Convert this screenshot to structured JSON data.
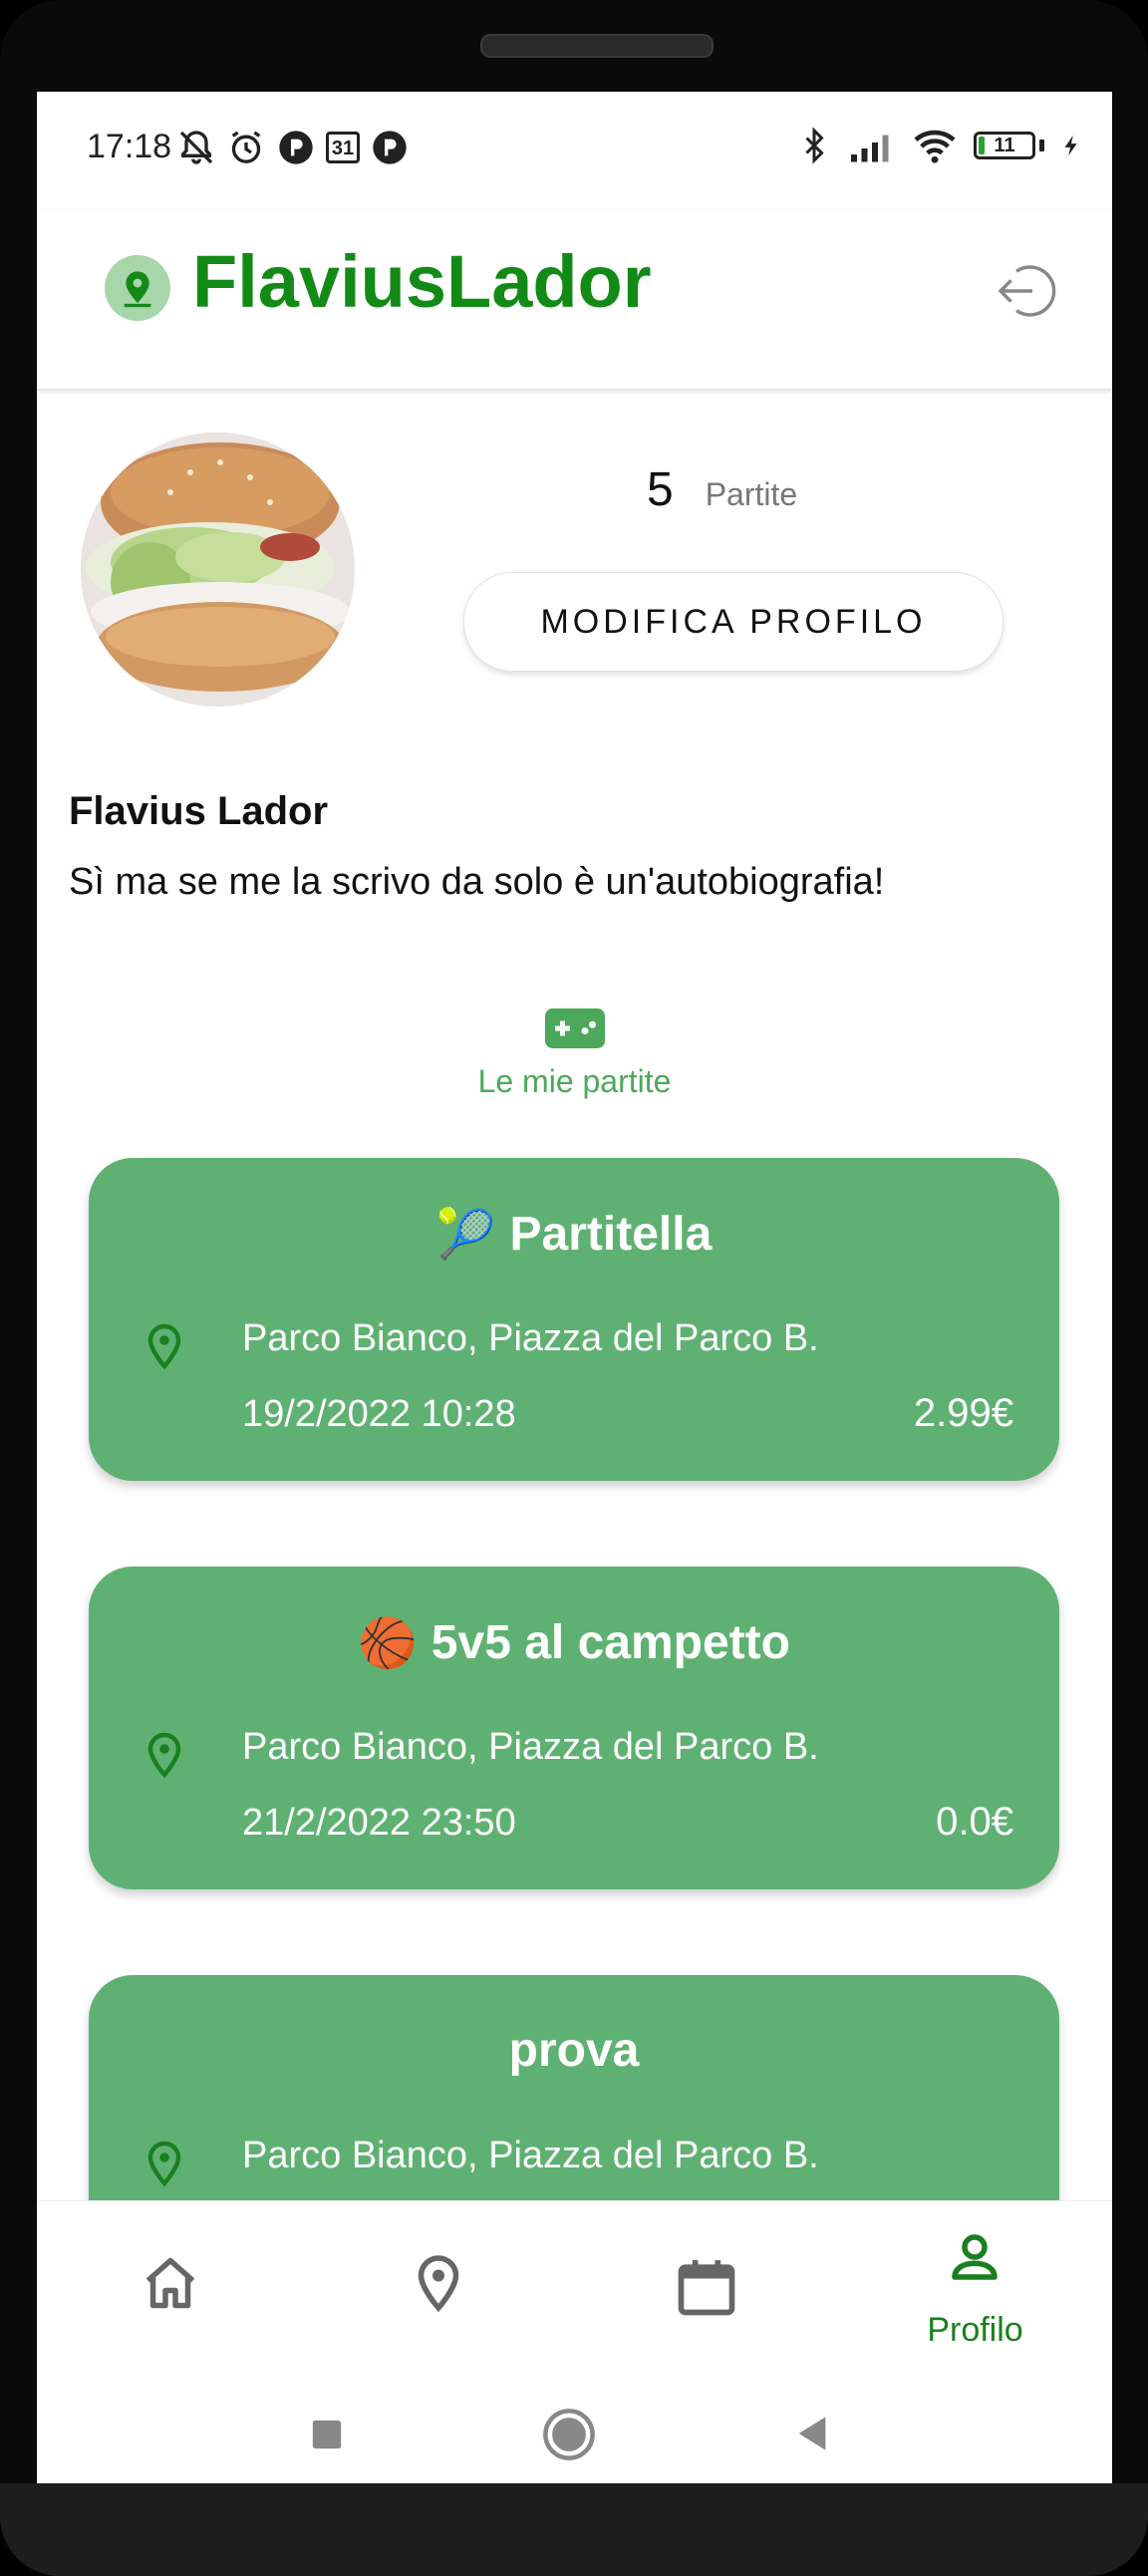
{
  "status_bar": {
    "time": "17:18",
    "left_icons": [
      "mute-bell-icon",
      "alarm-icon",
      "app-notification-icon",
      "calendar-31-icon",
      "app-notification-icon"
    ],
    "calendar_day": "31",
    "right_icons": [
      "bluetooth-icon",
      "signal-icon",
      "wifi-icon",
      "battery-icon",
      "charging-icon"
    ],
    "battery_level": "11"
  },
  "app": {
    "title": "FlaviusLador",
    "accent_color": "#138a16",
    "card_color": "#5fb173"
  },
  "profile": {
    "matches_count": "5",
    "matches_label": "Partite",
    "edit_button": "MODIFICA PROFILO",
    "full_name": "Flavius Lador",
    "bio": "Sì ma se me la scrivo da solo è un'autobiografia!"
  },
  "games_tab": {
    "icon": "gamepad-icon",
    "label": "Le mie partite"
  },
  "matches": [
    {
      "emoji": "🎾",
      "title": "Partitella",
      "address": "Parco Bianco, Piazza del Parco B.",
      "datetime": "19/2/2022 10:28",
      "price": "2.99€"
    },
    {
      "emoji": "🏀",
      "title": "5v5 al campetto",
      "address": "Parco Bianco, Piazza del Parco B.",
      "datetime": "21/2/2022 23:50",
      "price": "0.0€"
    },
    {
      "emoji": "",
      "title": "prova",
      "address": "Parco Bianco, Piazza del Parco B.",
      "datetime": "",
      "price": ""
    }
  ],
  "bottom_nav": {
    "items": [
      {
        "icon": "home-icon",
        "label": ""
      },
      {
        "icon": "map-pin-icon",
        "label": ""
      },
      {
        "icon": "calendar-icon",
        "label": ""
      },
      {
        "icon": "person-icon",
        "label": "Profilo",
        "active": true
      }
    ]
  },
  "system_nav": [
    "recents-square-icon",
    "home-circle-icon",
    "back-triangle-icon"
  ]
}
